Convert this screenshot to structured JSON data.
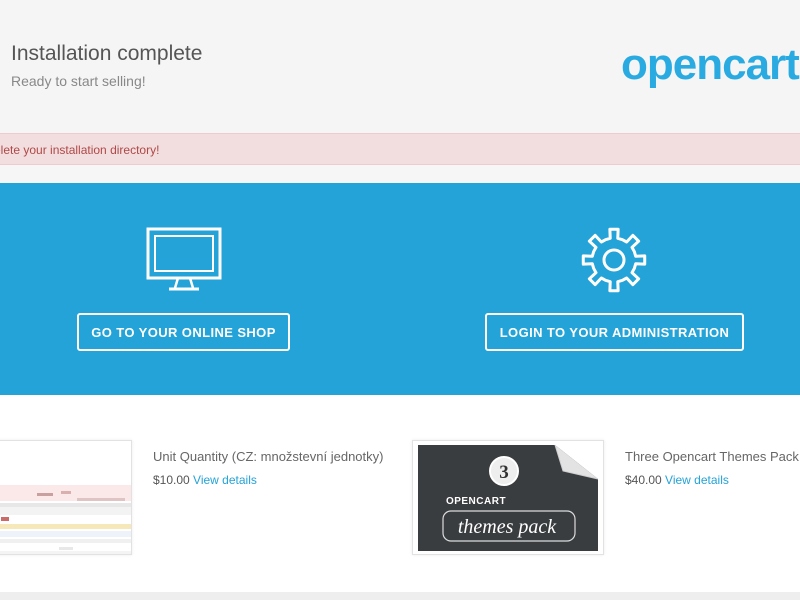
{
  "header": {
    "title": "Installation complete",
    "subtitle": "Ready to start selling!",
    "logo_text": "opencart"
  },
  "alert": {
    "text": "elete your installation directory!"
  },
  "hero": {
    "shop_button": "GO TO YOUR ONLINE SHOP",
    "admin_button": "LOGIN TO YOUR ADMINISTRATION",
    "shop_icon": "monitor-icon",
    "admin_icon": "gear-icon"
  },
  "extensions": [
    {
      "name": "Unit Quantity (CZ: množstevní jednotky)",
      "price": "$10.00",
      "link": "View details"
    },
    {
      "name": "Three Opencart Themes Pack",
      "price": "$40.00",
      "link": "View details",
      "thumb_number": "3",
      "thumb_label": "OPENCART",
      "thumb_title": "themes pack"
    }
  ],
  "colors": {
    "hero_bg": "#23a3d7",
    "logo": "#29abe2",
    "alert_bg": "#f2dede",
    "alert_text": "#b04848",
    "link": "#23a3d7"
  }
}
